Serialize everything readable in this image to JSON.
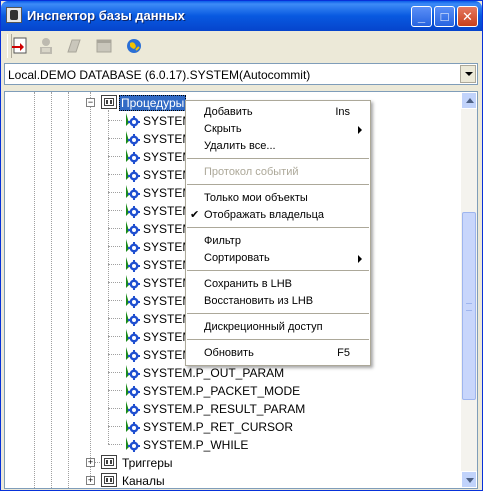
{
  "window": {
    "title": "Инспектор базы данных",
    "minimize": "_",
    "maximize": "□",
    "close": "✕"
  },
  "toolbar": {
    "icons": [
      "add-object-icon",
      "user-icon",
      "book-icon",
      "window-icon",
      "globe-icon"
    ]
  },
  "connection": {
    "value": "Local.DEMO DATABASE (6.0.17).SYSTEM(Autocommit)"
  },
  "tree": {
    "procedures": {
      "label": "Процедуры",
      "expander": "−"
    },
    "items": [
      "SYSTEM.",
      "SYSTEM.",
      "SYSTEM.",
      "SYSTEM.",
      "SYSTEM.",
      "SYSTEM.",
      "SYSTEM.",
      "SYSTEM.",
      "SYSTEM.",
      "SYSTEM.",
      "SYSTEM.",
      "SYSTEM.",
      "SYSTEM.",
      "SYSTEM.",
      "SYSTEM.P_OUT_PARAM",
      "SYSTEM.P_PACKET_MODE",
      "SYSTEM.P_RESULT_PARAM",
      "SYSTEM.P_RET_CURSOR",
      "SYSTEM.P_WHILE"
    ],
    "triggers": {
      "label": "Триггеры",
      "expander": "+"
    },
    "channels": {
      "label": "Каналы",
      "expander": "+"
    }
  },
  "context_menu": {
    "items": [
      {
        "label": "Добавить",
        "shortcut": "Ins"
      },
      {
        "label": "Скрыть",
        "submenu": true
      },
      {
        "label": "Удалить все..."
      },
      {
        "label": "Протокол событий",
        "disabled": true
      },
      {
        "label": "Только мои объекты"
      },
      {
        "label": "Отображать владельца",
        "checked": true,
        "check": "✔"
      },
      {
        "label": "Фильтр"
      },
      {
        "label": "Сортировать",
        "submenu": true
      },
      {
        "label": "Сохранить в LHB"
      },
      {
        "label": "Восстановить из LHB"
      },
      {
        "label": "Дискреционный доступ"
      },
      {
        "label": "Обновить",
        "shortcut": "F5"
      }
    ]
  },
  "colors": {
    "title_bar": "#0859e0",
    "selection": "#316ac5",
    "disabled_text": "#aca899"
  }
}
